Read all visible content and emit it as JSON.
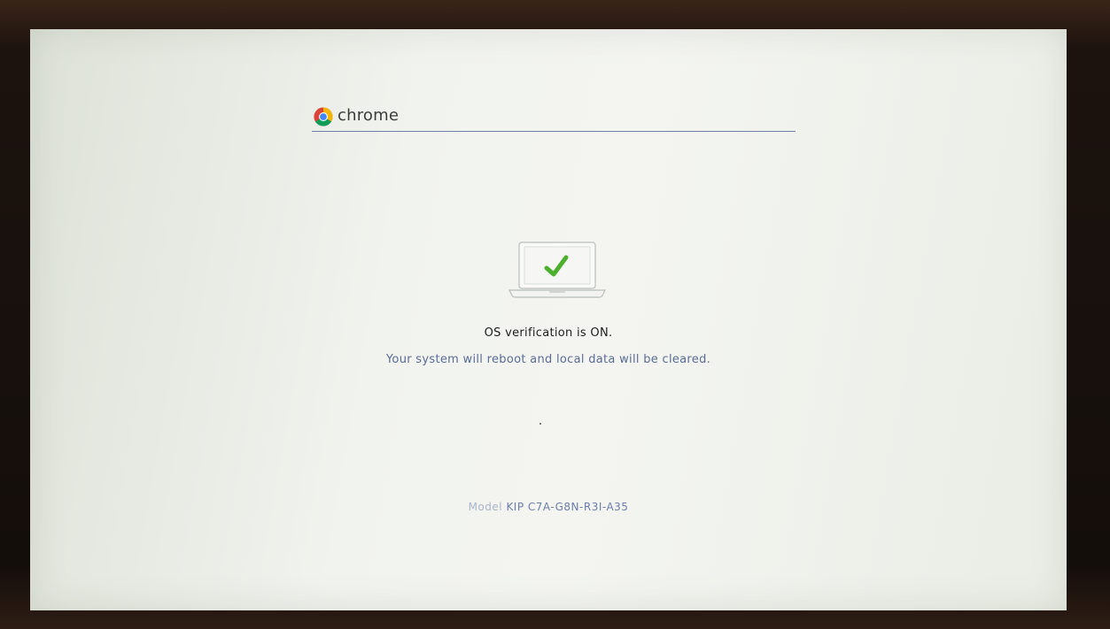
{
  "header": {
    "brand": "chrome",
    "logo_icon": "chrome-logo-icon"
  },
  "status": {
    "illustration_icon": "laptop-checkmark-icon",
    "title": "OS verification is ON.",
    "subtitle": "Your system will reboot and local data will be cleared."
  },
  "model": {
    "label": "Model",
    "value": "KIP C7A-G8N-R3I-A35"
  },
  "colors": {
    "background": "#f1f3ee",
    "header_rule": "#6d7fa8",
    "subtitle_text": "#5a6b96",
    "checkmark": "#4caf2e"
  }
}
